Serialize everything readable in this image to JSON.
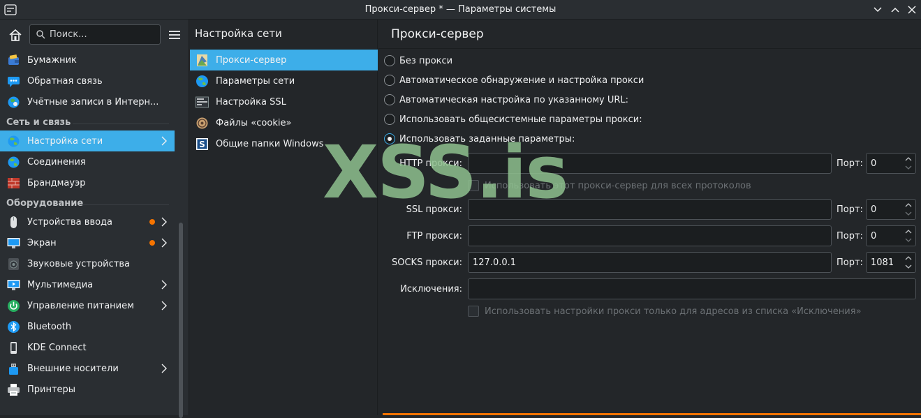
{
  "window": {
    "title": "Прокси-сервер * — Параметры системы"
  },
  "sidebar": {
    "search_placeholder": "Поиск...",
    "items_top": [
      {
        "label": "Бумажник",
        "icon": "wallet-icon"
      },
      {
        "label": "Обратная связь",
        "icon": "feedback-icon"
      },
      {
        "label": "Учётные записи в Интерн...",
        "icon": "online-accounts-icon"
      }
    ],
    "section_network": "Сеть и связь",
    "items_network": [
      {
        "label": "Настройка сети",
        "icon": "network-settings-icon",
        "active": true
      },
      {
        "label": "Соединения",
        "icon": "connections-icon"
      },
      {
        "label": "Брандмауэр",
        "icon": "firewall-icon"
      }
    ],
    "section_hardware": "Оборудование",
    "items_hardware": [
      {
        "label": "Устройства ввода",
        "icon": "mouse-icon"
      },
      {
        "label": "Экран",
        "icon": "display-icon"
      },
      {
        "label": "Звуковые устройства",
        "icon": "speaker-icon"
      },
      {
        "label": "Мультимедиа",
        "icon": "multimedia-icon"
      },
      {
        "label": "Управление питанием",
        "icon": "power-icon"
      },
      {
        "label": "Bluetooth",
        "icon": "bluetooth-icon"
      },
      {
        "label": "KDE Connect",
        "icon": "kde-connect-icon"
      },
      {
        "label": "Внешние носители",
        "icon": "usb-drive-icon"
      },
      {
        "label": "Принтеры",
        "icon": "printer-icon"
      }
    ]
  },
  "middle": {
    "title": "Настройка сети",
    "items": [
      {
        "label": "Прокси-сервер",
        "icon": "proxy-icon",
        "active": true
      },
      {
        "label": "Параметры сети",
        "icon": "globe-icon"
      },
      {
        "label": "Настройка SSL",
        "icon": "ssl-icon"
      },
      {
        "label": "Файлы «cookie»",
        "icon": "cookie-icon"
      },
      {
        "label": "Общие папки Windows",
        "icon": "samba-icon"
      }
    ]
  },
  "proxy": {
    "title": "Прокси-сервер",
    "options": [
      "Без прокси",
      "Автоматическое обнаружение и настройка прокси",
      "Автоматическая настройка по указанному URL:",
      "Использовать общесистемные параметры прокси:",
      "Использовать заданные параметры:"
    ],
    "selected_option": 4,
    "http_label": "HTTP прокси:",
    "http_value": "",
    "http_port": "0",
    "use_for_all": "Использовать этот прокси-сервер для всех протоколов",
    "ssl_label": "SSL прокси:",
    "ssl_value": "",
    "ssl_port": "0",
    "ftp_label": "FTP прокси:",
    "ftp_value": "",
    "ftp_port": "0",
    "socks_label": "SOCKS прокси:",
    "socks_value": "127.0.0.1",
    "socks_port": "1081",
    "port_label": "Порт:",
    "exceptions_label": "Исключения:",
    "exceptions_value": "",
    "exceptions_only": "Использовать настройки прокси только для адресов из списка «Исключения»"
  },
  "watermark": "XSS.is",
  "colors": {
    "accent": "#3daee9",
    "badge": "#f67400",
    "background": "#232629"
  }
}
